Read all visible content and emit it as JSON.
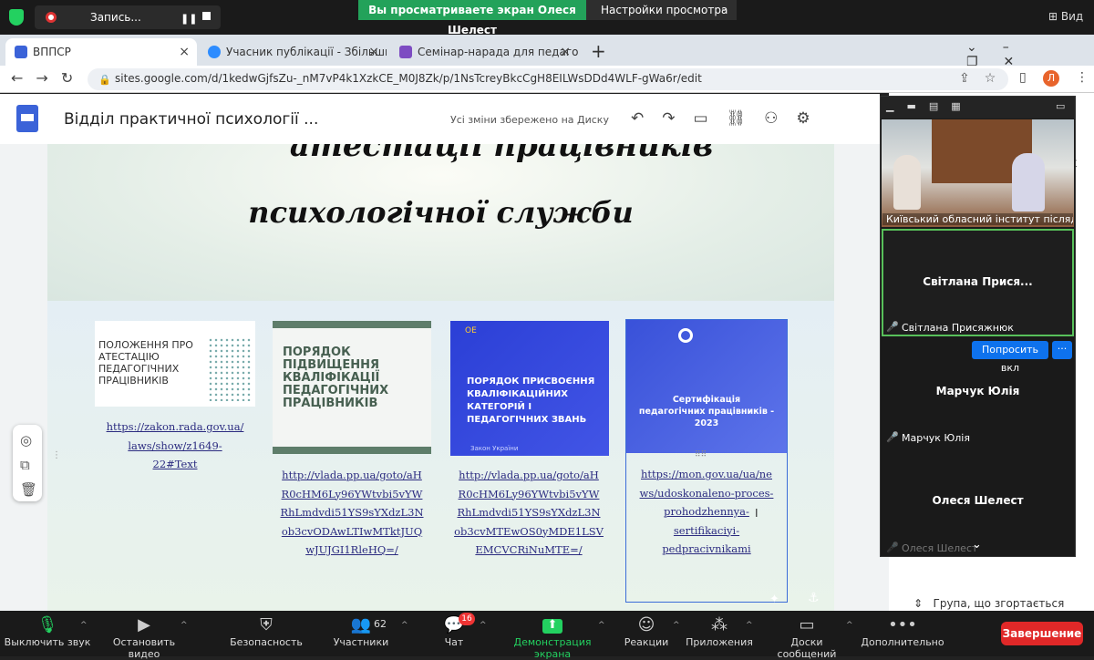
{
  "zoom_top": {
    "recording_label": "Запись...",
    "viewing_banner": "Вы просматриваете экран Олеся Шелест",
    "view_settings": "Настройки просмотра",
    "view_label": "Вид"
  },
  "browser": {
    "tabs": [
      {
        "title": "ВППСР",
        "close": "×"
      },
      {
        "title": "Учасник публікації - Збільшити",
        "close": "×"
      },
      {
        "title": "Семінар-нарада для педагогічн",
        "close": "×"
      }
    ],
    "new_tab": "+",
    "window_controls": "⌄–❐✕",
    "nav": "←→↻",
    "url": "sites.google.com/d/1kedwGjfsZu-_nM7vP4k1XzkCE_M0J8Zk/p/1NsTcreyBkcCgH8EILWsDDd4WLF-gWa6r/edit",
    "url_icons": "⇪☆",
    "profile_initial": "Л",
    "menu": "⋮"
  },
  "sites_header": {
    "title": "Відділ практичної психології ...",
    "saved_message": "Усі зміни збережено на Диску",
    "toolbar_icons": "↶↷▭⛓⚇⚙"
  },
  "page": {
    "heading_line1": "атестації працівників",
    "heading_line2": "психологічної служби",
    "cards": [
      {
        "image_title": "ПОЛОЖЕННЯ ПРО АТЕСТАЦІЮ ПЕДАГОГІЧНИХ ПРАЦІВНИКІВ",
        "link_lines": [
          "https://zakon.rada.gov.ua/",
          "laws/show/z1649-",
          "22#Text"
        ]
      },
      {
        "image_title": "ПОРЯДОК ПІДВИЩЕННЯ КВАЛІФІКАЦІЇ ПЕДАГОГІЧНИХ ПРАЦІВНИКІВ",
        "link_lines": [
          "http://vlada.pp.ua/goto/aH",
          "R0cHM6Ly96YWtvbi5vYW",
          "RhLmdvdi51YS9sYXdzL3N",
          "ob3cvODAwLTIwMTktJUQ",
          "wJUJGI1RleHQ=/"
        ]
      },
      {
        "image_mark": "ОЕ",
        "image_title": "ПОРЯДОК ПРИСВОЄННЯ КВАЛІФІКАЦІЙНИХ КАТЕГОРІЙ І ПЕДАГОГІЧНИХ ЗВАНЬ",
        "image_footer": "Закон України",
        "link_lines": [
          "http://vlada.pp.ua/goto/aH",
          "R0cHM6Ly96YWtvbi5vYW",
          "RhLmdvdi51YS9sYXdzL3N",
          "ob3cvMTEwOS0yMDE1LSV",
          "EMCVCRiNuMTE=/"
        ]
      },
      {
        "image_title": "Сертифікація педагогічних працівників - 2023",
        "link_lines": [
          "https://mon.gov.ua/ua/ne",
          "ws/udoskonaleno-proces-",
          "prohodzhennya-",
          "sertifikaciyi-",
          "pedpracivnikami"
        ]
      }
    ],
    "floating_tools": "◎\n⧉\n🗑"
  },
  "right_panel": {
    "group_label": "Група, що згортається"
  },
  "zoom_panel": {
    "toolbar_icons": "▁▬▤▦",
    "participants": [
      {
        "label": "Київський обласний інститут післядипломної освіти"
      },
      {
        "display_name": "Світлана  Прися...",
        "label": "Світлана Присяжнюк",
        "mic": "🎤"
      },
      {
        "display_name": "Марчук Юлія",
        "label": "Марчук Юлія",
        "mic": "🎤"
      },
      {
        "display_name": "Олеся Шелест",
        "label": "Олеся Шелест",
        "mic": "🎤"
      }
    ],
    "ask_button": "Попросить вкл",
    "more_button": "···",
    "chevron": "⌄"
  },
  "zoom_bar": {
    "items": [
      {
        "label": "Выключить звук",
        "icon": "🎙"
      },
      {
        "label": "Остановить видео",
        "icon": "▶"
      },
      {
        "label": "Безопасность",
        "icon": "⛨"
      },
      {
        "label": "Участники",
        "icon": "👥"
      },
      {
        "label": "Чат",
        "icon": "💬"
      },
      {
        "label": "Демонстрация экрана",
        "icon": "⬆"
      },
      {
        "label": "Реакции",
        "icon": "☺"
      },
      {
        "label": "Приложения",
        "icon": "⁂"
      },
      {
        "label": "Доски сообщений",
        "icon": "▭"
      },
      {
        "label": "Дополнительно",
        "icon": "•••"
      }
    ],
    "participants_count": "62",
    "chat_badge": "16",
    "end_button": "Завершение"
  },
  "colors": {
    "zoom_green": "#23d160",
    "zoom_end_red": "#e02828",
    "zoom_blue": "#0e72ed",
    "sites_blue": "#3b63d8",
    "active_speaker_border": "#58c05a"
  }
}
